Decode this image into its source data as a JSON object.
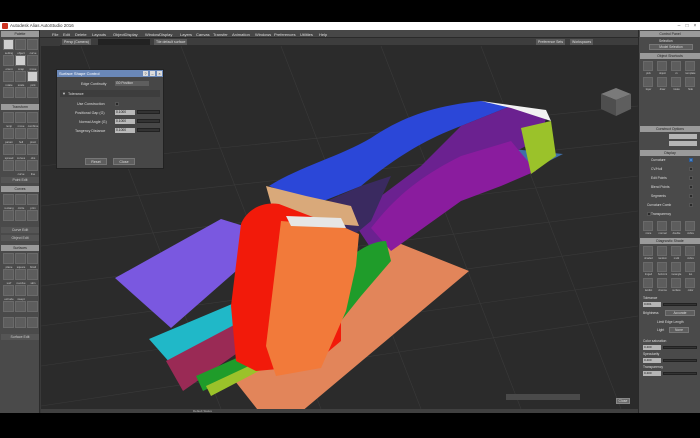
{
  "window": {
    "title": "Autodesk Alias AutoStudio 2016"
  },
  "menubar": {
    "items": [
      "File",
      "Edit",
      "Delete",
      "Layouts",
      "ObjectDisplay",
      "WindowDisplay",
      "Layers",
      "Canvas",
      "Transfer",
      "Animation",
      "Windows",
      "Preferences",
      "Utilities",
      "Help"
    ]
  },
  "shelf": {
    "tabs": [
      "Persp (Camera)",
      "Tile default surface"
    ],
    "right_tabs": [
      "Preference Sets",
      "Workspaces"
    ]
  },
  "left_palette": {
    "sections": [
      {
        "header": "Palette",
        "foot": ""
      },
      {
        "header": "Transform",
        "foot": ""
      },
      {
        "header": "Point Edit",
        "foot": "Point Edit"
      },
      {
        "header": "Curves",
        "foot": "Curve Edit"
      },
      {
        "header": "Object Edit",
        "foot": ""
      },
      {
        "header": "Surfaces",
        "foot": "Surface Edit"
      }
    ],
    "labels": [
      "setting",
      "object",
      "curve",
      "orient",
      "snap",
      "move",
      "rotate",
      "scale",
      "pick",
      "move",
      "transform",
      "scale",
      "nonp",
      "move",
      "combine",
      "param",
      "hull",
      "pivot",
      "spread",
      "curves",
      "obs",
      "curve",
      "line",
      "rectang",
      "circle",
      "prim",
      "spline",
      "edit",
      "fillet",
      "trim",
      "loop",
      "offset",
      "plane",
      "square",
      "birail",
      "surf",
      "revolve",
      "skin",
      "extrude",
      "swept"
    ]
  },
  "dialog": {
    "title": "Surface Shape Control",
    "edge_label": "Edge Continuity",
    "edge_value": "G0 Position",
    "tolerance_label": "Tolerance",
    "use_construction": "Use Construction",
    "rows": [
      {
        "label": "Positional Gap (G)",
        "value": "0.1000"
      },
      {
        "label": "Normal Angle (G)",
        "value": "0.1000"
      },
      {
        "label": "Tangency Distance",
        "value": "0.1000"
      }
    ],
    "buttons": [
      "Reset",
      "Close"
    ]
  },
  "right_palette": {
    "control_panel": "Control Panel",
    "selection_label": "Selection",
    "mode_label": "Model Selection",
    "sections": [
      "Object Shortcuts",
      "Construct Options",
      "Display",
      "Diagnostic Shade"
    ],
    "shortcut_labels": [
      "pick",
      "object",
      "cv",
      "template",
      "layer",
      "draw",
      "rotate",
      "hide"
    ],
    "display_rows": [
      {
        "label": "Curvature",
        "checked": true
      },
      {
        "label": "CV/Hull",
        "checked": false
      },
      {
        "label": "Edit Points",
        "checked": false
      },
      {
        "label": "Blend Points",
        "checked": false
      },
      {
        "label": "Segments",
        "checked": false
      },
      {
        "label": "Curvature Comb",
        "checked": false
      },
      {
        "label": "Transparency",
        "checked": false
      }
    ],
    "display_options": [
      "none",
      "normal",
      "double",
      "zebra"
    ],
    "diagnostic_labels": [
      "shaded",
      "random",
      "multi",
      "zebra",
      "tinged",
      "horizont",
      "isoangle",
      "iso",
      "isodist",
      "cinema",
      "surface",
      "color"
    ],
    "settings": [
      {
        "label": "Tolerance",
        "value": "0.001"
      },
      {
        "label": "Brightness",
        "value": "Accurate"
      },
      {
        "label": "Limit Edge Length",
        "value": ""
      },
      {
        "label": "Light",
        "value": "None"
      },
      {
        "label": "Color saturation",
        "value": "0.400"
      },
      {
        "label": "Specularity",
        "value": "0.400"
      },
      {
        "label": "Transparency",
        "value": "0.400"
      }
    ],
    "close_label": "Close"
  },
  "viewport": {
    "status_bar": "Default Status",
    "colors": {
      "background": "#2b2b2b",
      "grid": "#3c3c3c",
      "blue": "#2b47d8",
      "purple": "#6b2190",
      "magenta": "#8a1c9e",
      "green": "#1f9c2a",
      "lime": "#9bc22a",
      "red": "#f21a0a",
      "orange": "#f27a3a",
      "violet": "#7a58e0",
      "teal": "#20b8c8",
      "tan": "#d9a97a",
      "maroon": "#9a2a55",
      "salmon": "#e2855a",
      "light_blue": "#3f6fa8"
    }
  }
}
